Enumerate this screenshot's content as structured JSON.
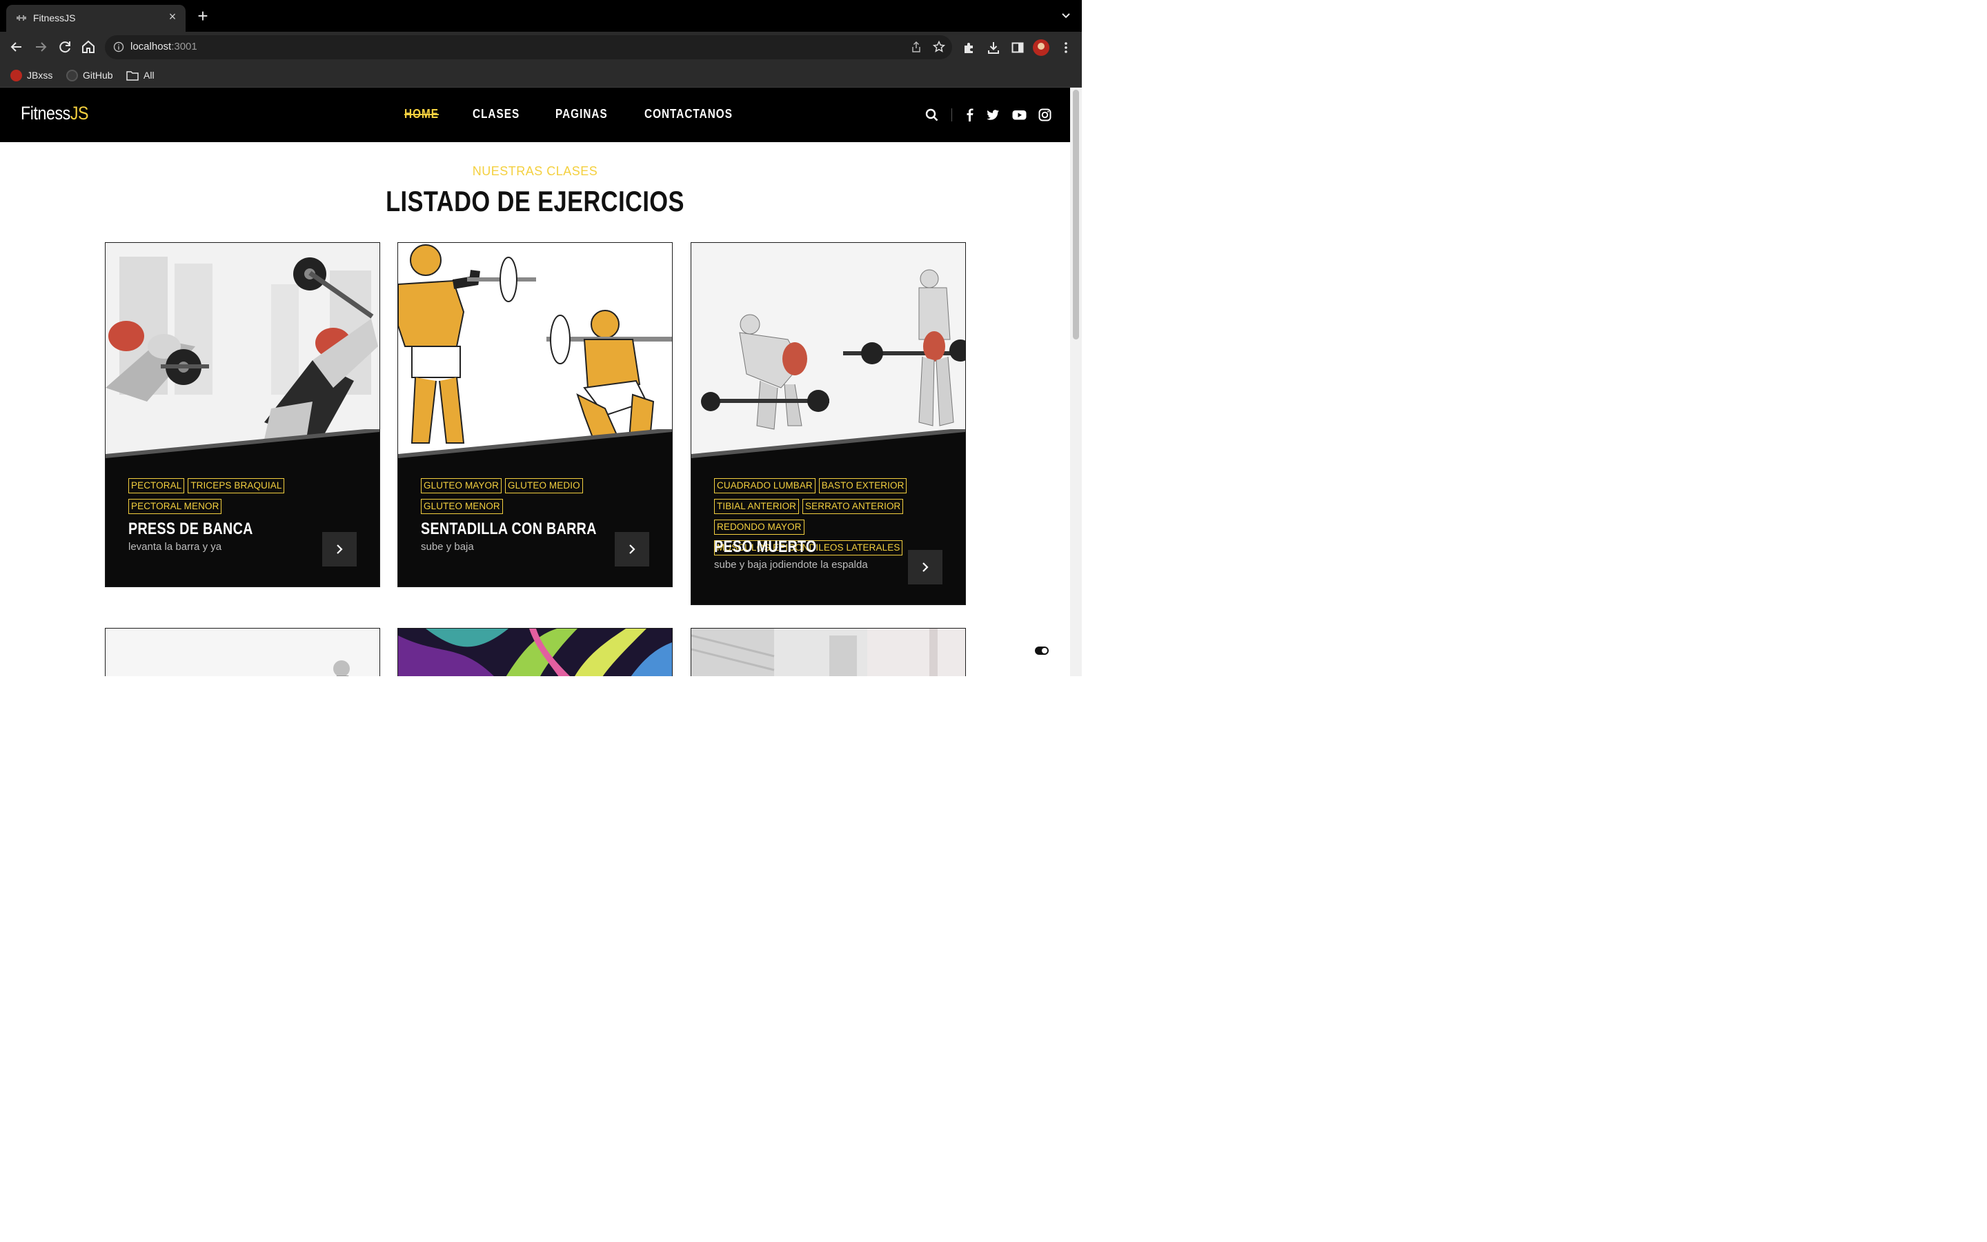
{
  "browser": {
    "tab_title": "FitnessJS",
    "url_host": "localhost",
    "url_port": ":3001",
    "bookmarks": [
      {
        "label": "JBxss",
        "icon": "avatar-icon"
      },
      {
        "label": "GitHub",
        "icon": "github-icon"
      },
      {
        "label": "All",
        "icon": "folder-icon"
      }
    ]
  },
  "site": {
    "logo_main": "Fitness",
    "logo_accent": "JS",
    "nav": [
      "HOME",
      "CLASES",
      "PAGINAS",
      "CONTACTANOS"
    ],
    "active_nav": "HOME",
    "social": [
      "search-icon",
      "facebook-icon",
      "twitter-icon",
      "youtube-icon",
      "instagram-icon"
    ],
    "accent_color": "#f4d03f"
  },
  "section": {
    "eyebrow": "NUESTRAS CLASES",
    "title": "LISTADO DE EJERCICIOS"
  },
  "cards": [
    {
      "tags": [
        "PECTORAL",
        "TRICEPS BRAQUIAL",
        "PECTORAL MENOR"
      ],
      "title": "PRESS DE BANCA",
      "subtitle": "levanta la barra y ya"
    },
    {
      "tags": [
        "GLUTEO MAYOR",
        "GLUTEO MEDIO",
        "GLUTEO MENOR"
      ],
      "title": "SENTADILLA CON BARRA",
      "subtitle": "sube y baja"
    },
    {
      "tags": [
        "CUADRADO LUMBAR",
        "BASTO EXTERIOR",
        "TIBIAL ANTERIOR",
        "SERRATO ANTERIOR",
        "REDONDO MAYOR",
        "MUSCULOS EPICONDILEOS LATERALES"
      ],
      "title": "PESO MUERTO",
      "subtitle": "sube y baja jodiendote la espalda"
    }
  ]
}
